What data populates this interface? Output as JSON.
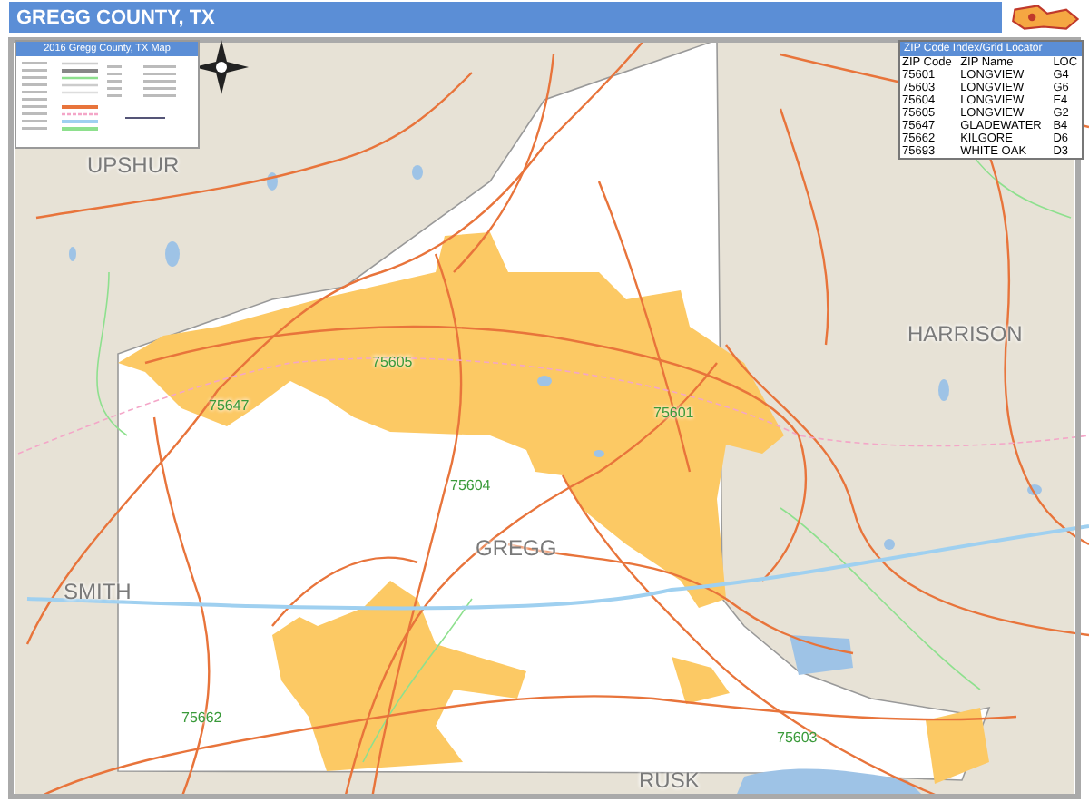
{
  "title": "GREGG COUNTY, TX",
  "legend": {
    "title": "2016 Gregg County, TX Map"
  },
  "zip_index": {
    "title": "ZIP Code Index/Grid Locator",
    "columns": [
      "ZIP Code",
      "ZIP Name",
      "LOC"
    ],
    "rows": [
      [
        "75601",
        "LONGVIEW",
        "G4"
      ],
      [
        "75603",
        "LONGVIEW",
        "G6"
      ],
      [
        "75604",
        "LONGVIEW",
        "E4"
      ],
      [
        "75605",
        "LONGVIEW",
        "G2"
      ],
      [
        "75647",
        "GLADEWATER",
        "B4"
      ],
      [
        "75662",
        "KILGORE",
        "D6"
      ],
      [
        "75693",
        "WHITE OAK",
        "D3"
      ]
    ]
  },
  "map": {
    "county_labels": [
      "UPSHUR",
      "HARRISON",
      "GREGG",
      "SMITH",
      "RUSK"
    ],
    "zip_labels": [
      "75605",
      "75647",
      "75604",
      "75601",
      "75662",
      "75603"
    ]
  }
}
